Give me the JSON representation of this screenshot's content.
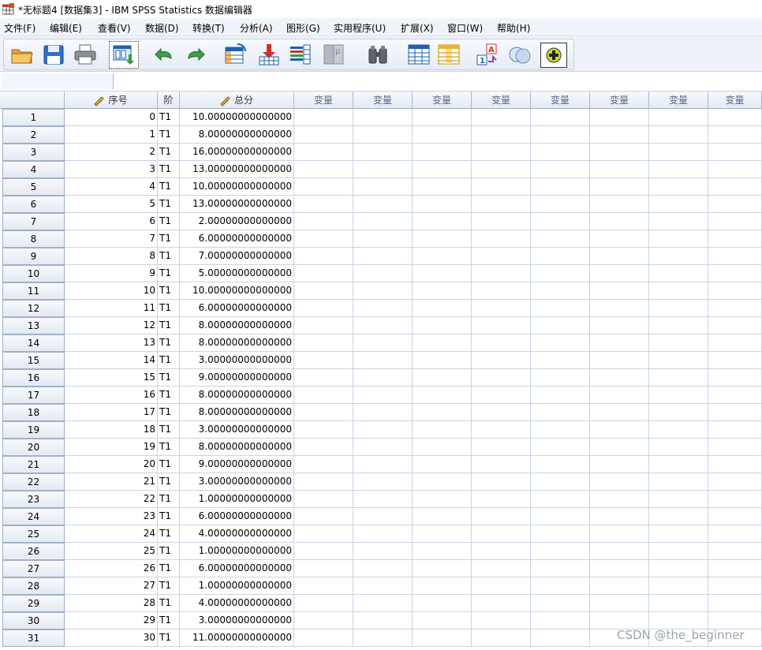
{
  "window": {
    "title": "*无标题4 [数据集3] - IBM SPSS Statistics 数据编辑器"
  },
  "menu": [
    "文件(F)",
    "编辑(E)",
    "查看(V)",
    "数据(D)",
    "转换(T)",
    "分析(A)",
    "图形(G)",
    "实用程序(U)",
    "扩展(X)",
    "窗口(W)",
    "帮助(H)"
  ],
  "toolbar": {
    "buttons": [
      "open-folder-icon",
      "save-icon",
      "print-icon",
      "recall-dialog-icon",
      "undo-icon",
      "redo-icon",
      "goto-case-icon",
      "goto-variable-icon",
      "variables-icon",
      "run-descriptives-icon",
      "find-icon",
      "insert-cases-icon",
      "insert-variable-icon",
      "split-file-icon",
      "weight-cases-icon",
      "select-cases-icon",
      "value-labels-icon",
      "use-variable-sets-icon"
    ]
  },
  "editbar": {
    "cell_ref": "",
    "cell_value": ""
  },
  "columns": [
    {
      "name": "序号",
      "scale_icon": true
    },
    {
      "name": "阶",
      "scale_icon": false
    },
    {
      "name": "总分",
      "scale_icon": true
    },
    {
      "name": "变量",
      "empty": true
    },
    {
      "name": "变量",
      "empty": true
    },
    {
      "name": "变量",
      "empty": true
    },
    {
      "name": "变量",
      "empty": true
    },
    {
      "name": "变量",
      "empty": true
    },
    {
      "name": "变量",
      "empty": true
    },
    {
      "name": "变量",
      "empty": true
    },
    {
      "name": "变量",
      "empty": true
    }
  ],
  "rows": [
    [
      "1",
      "0",
      "T1",
      "10.00000000000000"
    ],
    [
      "2",
      "1",
      "T1",
      "8.00000000000000"
    ],
    [
      "3",
      "2",
      "T1",
      "16.00000000000000"
    ],
    [
      "4",
      "3",
      "T1",
      "13.00000000000000"
    ],
    [
      "5",
      "4",
      "T1",
      "10.00000000000000"
    ],
    [
      "6",
      "5",
      "T1",
      "13.00000000000000"
    ],
    [
      "7",
      "6",
      "T1",
      "2.00000000000000"
    ],
    [
      "8",
      "7",
      "T1",
      "6.00000000000000"
    ],
    [
      "9",
      "8",
      "T1",
      "7.00000000000000"
    ],
    [
      "10",
      "9",
      "T1",
      "5.00000000000000"
    ],
    [
      "11",
      "10",
      "T1",
      "10.00000000000000"
    ],
    [
      "12",
      "11",
      "T1",
      "6.00000000000000"
    ],
    [
      "13",
      "12",
      "T1",
      "8.00000000000000"
    ],
    [
      "14",
      "13",
      "T1",
      "8.00000000000000"
    ],
    [
      "15",
      "14",
      "T1",
      "3.00000000000000"
    ],
    [
      "16",
      "15",
      "T1",
      "9.00000000000000"
    ],
    [
      "17",
      "16",
      "T1",
      "8.00000000000000"
    ],
    [
      "18",
      "17",
      "T1",
      "8.00000000000000"
    ],
    [
      "19",
      "18",
      "T1",
      "3.00000000000000"
    ],
    [
      "20",
      "19",
      "T1",
      "8.00000000000000"
    ],
    [
      "21",
      "20",
      "T1",
      "9.00000000000000"
    ],
    [
      "22",
      "21",
      "T1",
      "3.00000000000000"
    ],
    [
      "23",
      "22",
      "T1",
      "1.00000000000000"
    ],
    [
      "24",
      "23",
      "T1",
      "6.00000000000000"
    ],
    [
      "25",
      "24",
      "T1",
      "4.00000000000000"
    ],
    [
      "26",
      "25",
      "T1",
      "1.00000000000000"
    ],
    [
      "27",
      "26",
      "T1",
      "6.00000000000000"
    ],
    [
      "28",
      "27",
      "T1",
      "1.00000000000000"
    ],
    [
      "29",
      "28",
      "T1",
      "4.00000000000000"
    ],
    [
      "30",
      "29",
      "T1",
      "3.00000000000000"
    ],
    [
      "31",
      "30",
      "T1",
      "11.00000000000000"
    ]
  ],
  "watermark": "CSDN @the_beginner"
}
